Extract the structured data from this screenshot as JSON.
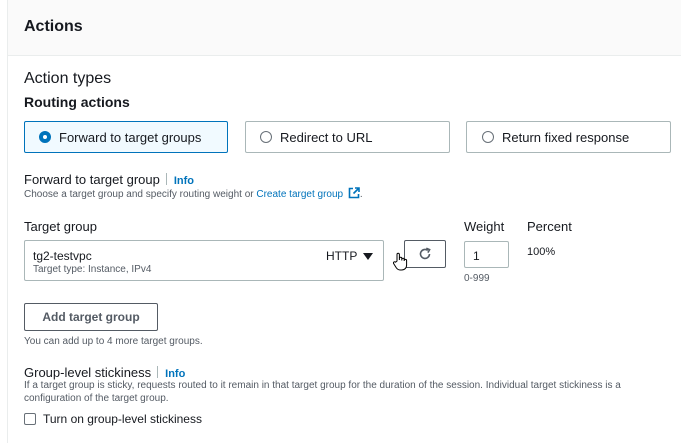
{
  "section": {
    "title": "Actions"
  },
  "action_types": {
    "title": "Action types",
    "routing_label": "Routing actions",
    "options": [
      {
        "label": "Forward to target groups",
        "selected": true
      },
      {
        "label": "Redirect to URL",
        "selected": false
      },
      {
        "label": "Return fixed response",
        "selected": false
      }
    ]
  },
  "forward": {
    "label": "Forward to target group",
    "info": "Info",
    "description": "Choose a target group and specify routing weight or ",
    "link": "Create target group",
    "period": "."
  },
  "table": {
    "target_group_header": "Target group",
    "weight_header": "Weight",
    "percent_header": "Percent",
    "rows": [
      {
        "name": "tg2-testvpc",
        "type": "Target type: Instance, IPv4",
        "protocol": "HTTP",
        "weight": "1",
        "weight_hint": "0-999",
        "percent": "100%"
      }
    ]
  },
  "add_button": {
    "label": "Add target group",
    "hint": "You can add up to 4 more target groups."
  },
  "stickiness": {
    "label": "Group-level stickiness",
    "info": "Info",
    "description_line1": "If a target group is sticky, requests routed to it remain in that target group for the duration of the session. Individual target stickiness is a",
    "description_line2": "configuration of the target group.",
    "checkbox_label": "Turn on group-level stickiness",
    "checked": false
  },
  "colors": {
    "accent": "#0073bb",
    "text": "#16191f",
    "muted": "#545b64",
    "border": "#aab7b8"
  }
}
